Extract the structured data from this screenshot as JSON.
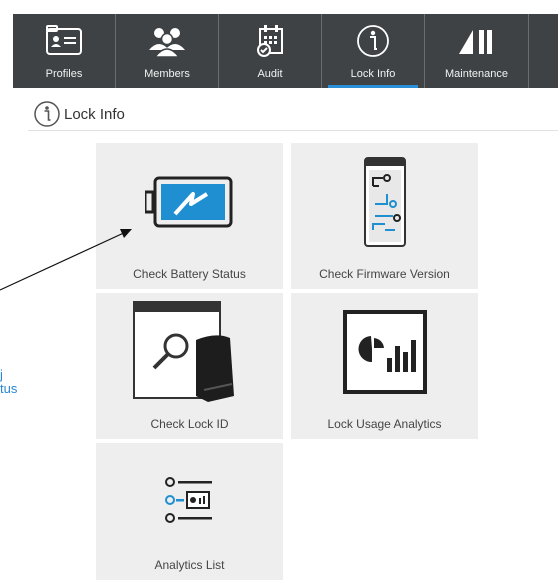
{
  "toolbar": {
    "tabs": [
      {
        "label": "Profiles",
        "icon": "profile-card-icon"
      },
      {
        "label": "Members",
        "icon": "members-icon"
      },
      {
        "label": "Audit",
        "icon": "audit-calendar-icon"
      },
      {
        "label": "Lock Info",
        "icon": "info-icon",
        "active": true
      },
      {
        "label": "Maintenance",
        "icon": "maintenance-icon"
      }
    ]
  },
  "section": {
    "title": "Lock Info"
  },
  "tiles": [
    {
      "label": "Check Battery Status",
      "icon": "battery-icon"
    },
    {
      "label": "Check Firmware Version",
      "icon": "firmware-chip-icon"
    },
    {
      "label": "Check Lock ID",
      "icon": "lock-id-magnifier-icon"
    },
    {
      "label": "Lock Usage Analytics",
      "icon": "usage-analytics-icon"
    },
    {
      "label": "Analytics List",
      "icon": "analytics-list-icon"
    }
  ],
  "callout": {
    "line1": "j",
    "line2": "tus"
  },
  "colors": {
    "toolbar": "#3e4245",
    "active_underline": "#2a8fd6",
    "accent": "#2b86d6",
    "tile_bg": "#eeeeee"
  }
}
